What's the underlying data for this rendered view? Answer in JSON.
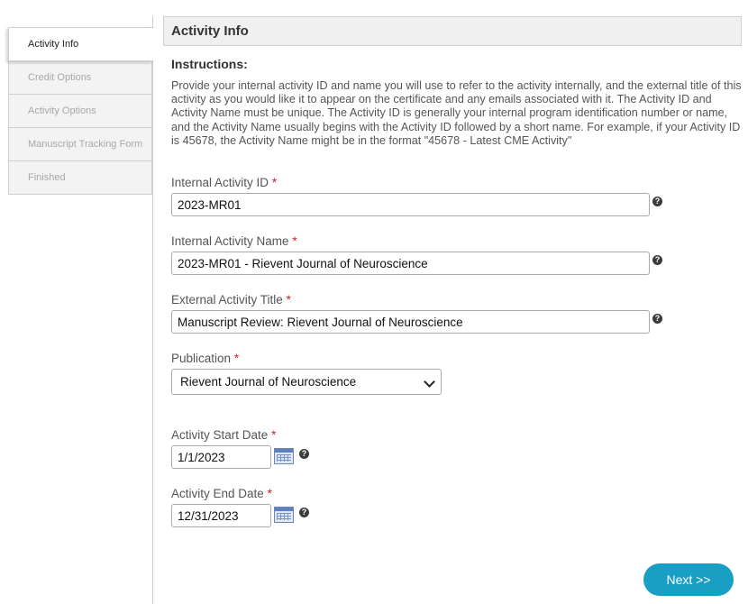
{
  "sidebar": {
    "items": [
      {
        "label": "Activity Info",
        "active": true
      },
      {
        "label": "Credit Options",
        "active": false
      },
      {
        "label": "Activity Options",
        "active": false
      },
      {
        "label": "Manuscript Tracking Form",
        "active": false
      },
      {
        "label": "Finished",
        "active": false
      }
    ]
  },
  "header": {
    "title": "Activity Info"
  },
  "instructions": {
    "title": "Instructions:",
    "text": "Provide your internal activity ID and name you will use to refer to the activity internally, and the external title of this activity as you would like it to appear on the certificate and any emails associated with it. The Activity ID and Activity Name must be unique. The Activity ID is generally your internal program identification number or name, and the Activity Name usually begins with the Activity ID followed by a short name. For example, if your Activity ID is 45678, the Activity Name might be in the format \"45678 - Latest CME Activity\""
  },
  "form": {
    "required_mark": "*",
    "internal_id": {
      "label": "Internal Activity ID",
      "value": "2023-MR01"
    },
    "internal_name": {
      "label": "Internal Activity Name",
      "value": "2023-MR01 - Rievent Journal of Neuroscience"
    },
    "external_title": {
      "label": "External Activity Title",
      "value": "Manuscript Review: Rievent Journal of Neuroscience"
    },
    "publication": {
      "label": "Publication",
      "selected": "Rievent Journal of Neuroscience"
    },
    "start_date": {
      "label": "Activity Start Date",
      "value": "1/1/2023"
    },
    "end_date": {
      "label": "Activity End Date",
      "value": "12/31/2023"
    },
    "help_glyph": "?"
  },
  "icons": {
    "help": "help-icon",
    "calendar": "calendar-icon",
    "dropdown": "chevron-down-icon"
  },
  "colors": {
    "accent": "#1a9fc4",
    "required": "#cc2222"
  },
  "actions": {
    "next_label": "Next >>"
  }
}
